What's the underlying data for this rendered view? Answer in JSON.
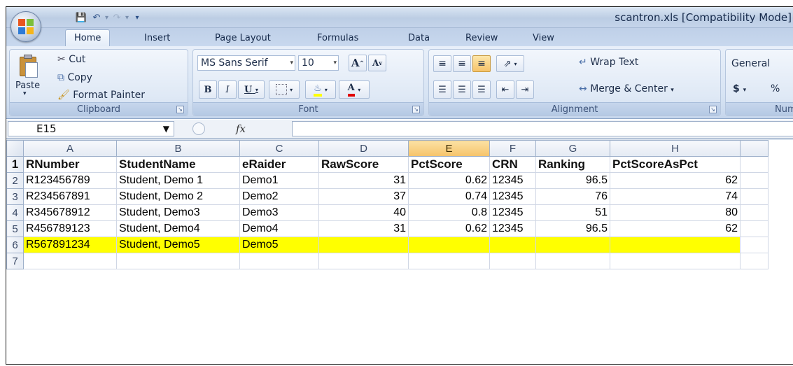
{
  "window": {
    "title": "scantron.xls  [Compatibility Mode]"
  },
  "ribbon_tabs": [
    "Home",
    "Insert",
    "Page Layout",
    "Formulas",
    "Data",
    "Review",
    "View"
  ],
  "clipboard": {
    "paste": "Paste",
    "cut": "Cut",
    "copy": "Copy",
    "format_painter": "Format Painter",
    "label": "Clipboard"
  },
  "font": {
    "name": "MS Sans Serif",
    "size": "10",
    "label": "Font",
    "bold": "B",
    "italic": "I",
    "underline": "U",
    "grow": "A",
    "shrink": "A",
    "font_color": "A"
  },
  "alignment": {
    "wrap": "Wrap Text",
    "merge": "Merge & Center",
    "label": "Alignment"
  },
  "number": {
    "format": "General",
    "currency": "$",
    "percent": "%",
    "label": "Number"
  },
  "formula_bar": {
    "name_box": "E15",
    "fx": "fx",
    "value": ""
  },
  "sheet": {
    "columns": [
      "A",
      "B",
      "C",
      "D",
      "E",
      "F",
      "G",
      "H"
    ],
    "rows": [
      {
        "n": "1",
        "cells": [
          "RNumber",
          "StudentName",
          "eRaider",
          "RawScore",
          "PctScore",
          "CRN",
          "Ranking",
          "PctScoreAsPct"
        ]
      },
      {
        "n": "2",
        "cells": [
          "R123456789",
          "Student, Demo 1",
          "Demo1",
          "31",
          "0.62",
          "12345",
          "96.5",
          "62"
        ]
      },
      {
        "n": "3",
        "cells": [
          "R234567891",
          "Student, Demo 2",
          "Demo2",
          "37",
          "0.74",
          "12345",
          "76",
          "74"
        ]
      },
      {
        "n": "4",
        "cells": [
          "R345678912",
          "Student, Demo3",
          "Demo3",
          "40",
          "0.8",
          "12345",
          "51",
          "80"
        ]
      },
      {
        "n": "5",
        "cells": [
          "R456789123",
          "Student, Demo4",
          "Demo4",
          "31",
          "0.62",
          "12345",
          "96.5",
          "62"
        ]
      },
      {
        "n": "6",
        "cells": [
          "R567891234",
          "Student, Demo5",
          "Demo5",
          "",
          "",
          "",
          "",
          ""
        ]
      },
      {
        "n": "7",
        "cells": [
          "",
          "",
          "",
          "",
          "",
          "",
          "",
          ""
        ]
      }
    ],
    "highlight_color": "#ffff00",
    "selected_column": "E"
  },
  "colors": {
    "ribbon": "#d6e3f3",
    "highlight": "#ffff00",
    "selected_header": "#f6c36a"
  }
}
